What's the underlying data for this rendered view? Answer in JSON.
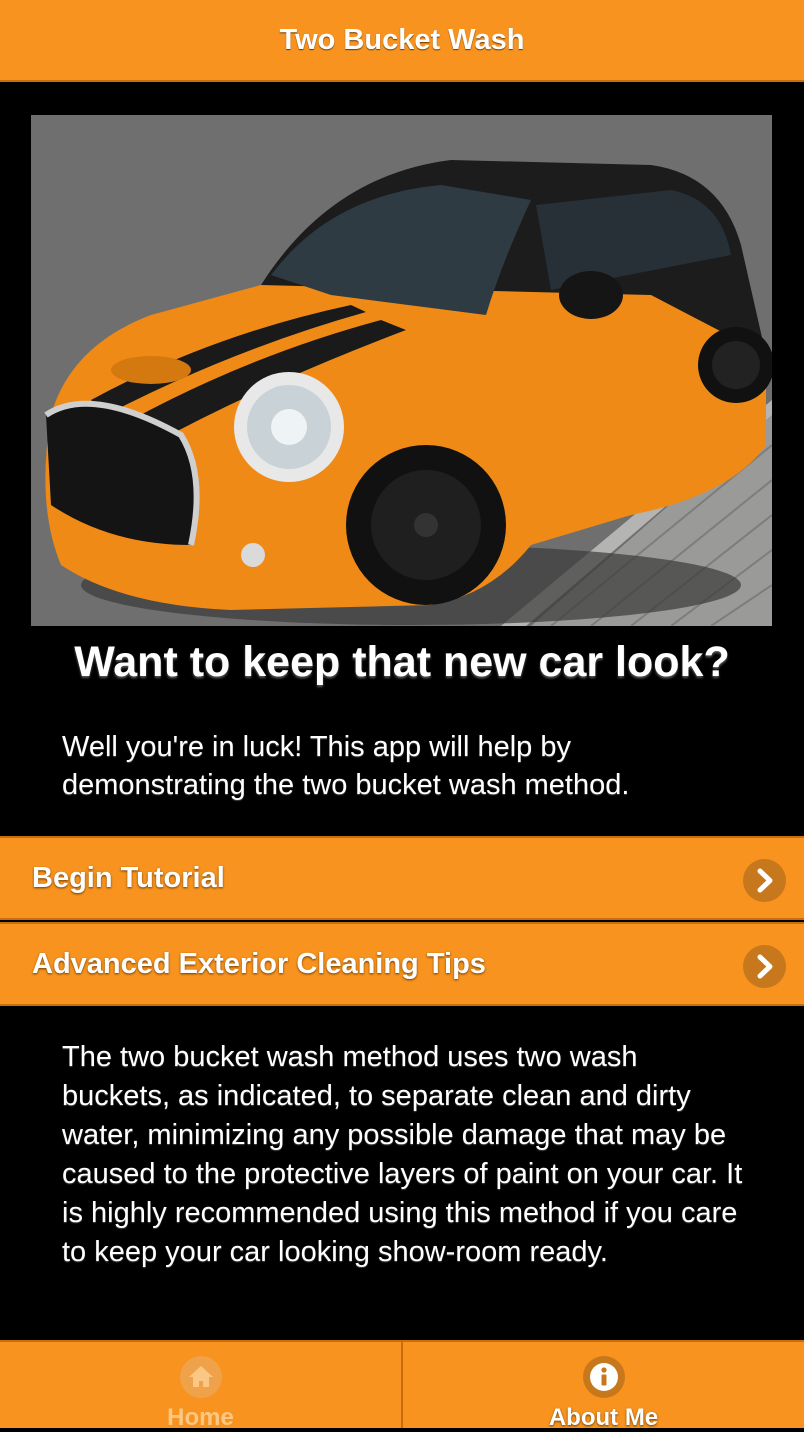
{
  "header": {
    "title": "Two Bucket Wash"
  },
  "hero": {
    "alt": "Orange car with black racing stripes"
  },
  "headline": "Want to keep that new car look?",
  "intro": "Well you're in luck! This app will help by demonstrating the two bucket wash method.",
  "menu": [
    {
      "label": "Begin Tutorial",
      "icon": "chevron-right-icon"
    },
    {
      "label": "Advanced Exterior Cleaning Tips",
      "icon": "chevron-right-icon"
    }
  ],
  "description": "The two bucket wash method uses two wash buckets, as indicated, to separate clean and dirty water, minimizing any possible damage that may be caused to the protective layers of paint on your car. It is highly recommended using this method if you care to keep your car looking show-room ready.",
  "footer": {
    "tabs": [
      {
        "label": "Home",
        "icon": "home-icon",
        "active": false
      },
      {
        "label": "About Me",
        "icon": "info-icon",
        "active": true
      }
    ]
  },
  "colors": {
    "accent": "#f7931e",
    "accent_dark": "#c86f0c",
    "background": "#000000"
  }
}
